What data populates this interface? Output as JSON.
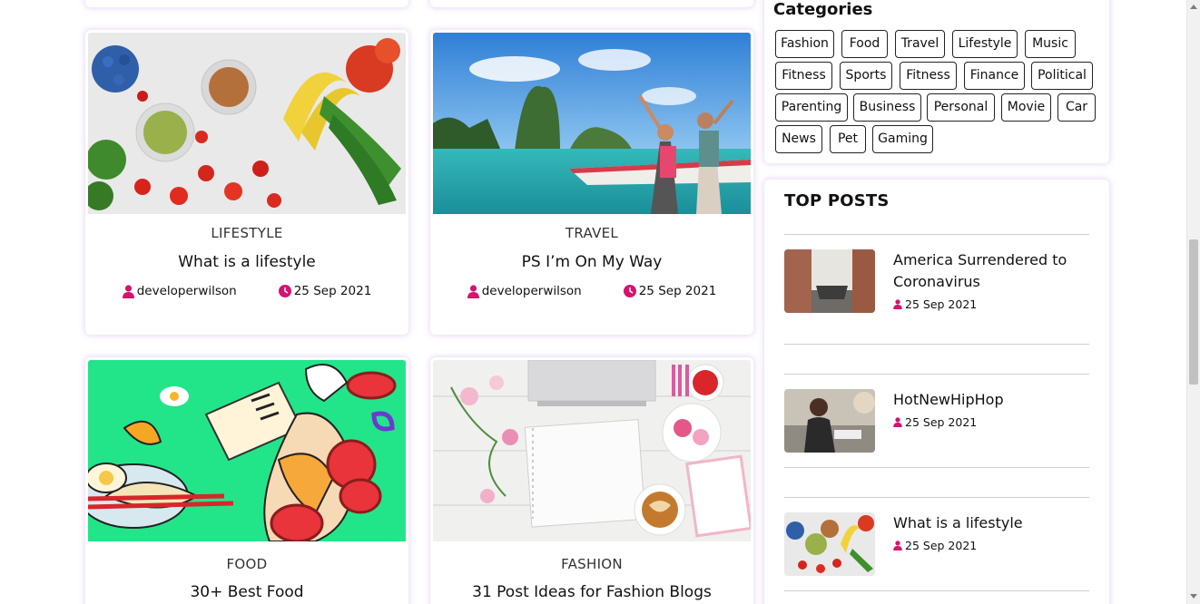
{
  "posts": [
    {
      "category": "LIFESTYLE",
      "title": "What is a lifestyle",
      "author": "developerwilson",
      "date": "25 Sep 2021"
    },
    {
      "category": "TRAVEL",
      "title": "PS I’m On My Way",
      "author": "developerwilson",
      "date": "25 Sep 2021"
    },
    {
      "category": "FOOD",
      "title": "30+ Best Food"
    },
    {
      "category": "FASHION",
      "title": "31 Post Ideas for Fashion Blogs"
    }
  ],
  "sidebar": {
    "categories_title": "Categories",
    "tags": [
      "Fashion",
      "Food",
      "Travel",
      "Lifestyle",
      "Music",
      "Fitness",
      "Sports",
      "Fitness",
      "Finance",
      "Political",
      "Parenting",
      "Business",
      "Personal",
      "Movie",
      "Car",
      "News",
      "Pet",
      "Gaming"
    ],
    "top_posts_title": "TOP POSTS",
    "top_posts": [
      {
        "title": "America Surrendered to Coronavirus",
        "date": "25 Sep 2021"
      },
      {
        "title": "HotNewHipHop",
        "date": "25 Sep 2021"
      },
      {
        "title": "What is a lifestyle",
        "date": "25 Sep 2021"
      }
    ]
  },
  "colors": {
    "accent": "#d6136e",
    "card_glow": "#e8d8f5"
  },
  "icons": {
    "author": "user-icon",
    "date": "clock-icon"
  }
}
